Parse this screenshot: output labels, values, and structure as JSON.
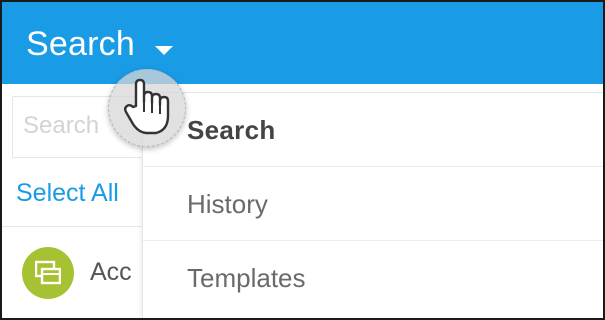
{
  "header": {
    "title": "Search",
    "dropdown_icon": "caret-down-icon",
    "background_color": "#1a9be6"
  },
  "panel": {
    "search_placeholder": "Search",
    "select_all_label": "Select All",
    "list_items": [
      {
        "label": "Acc",
        "icon": "dashboard-icon",
        "icon_color": "#a6c232"
      }
    ]
  },
  "dropdown": {
    "items": [
      {
        "label": "Search",
        "state": "active"
      },
      {
        "label": "History",
        "state": "inactive"
      },
      {
        "label": "Templates",
        "state": "inactive"
      }
    ]
  },
  "cursor": {
    "icon": "hand-pointer-icon"
  }
}
